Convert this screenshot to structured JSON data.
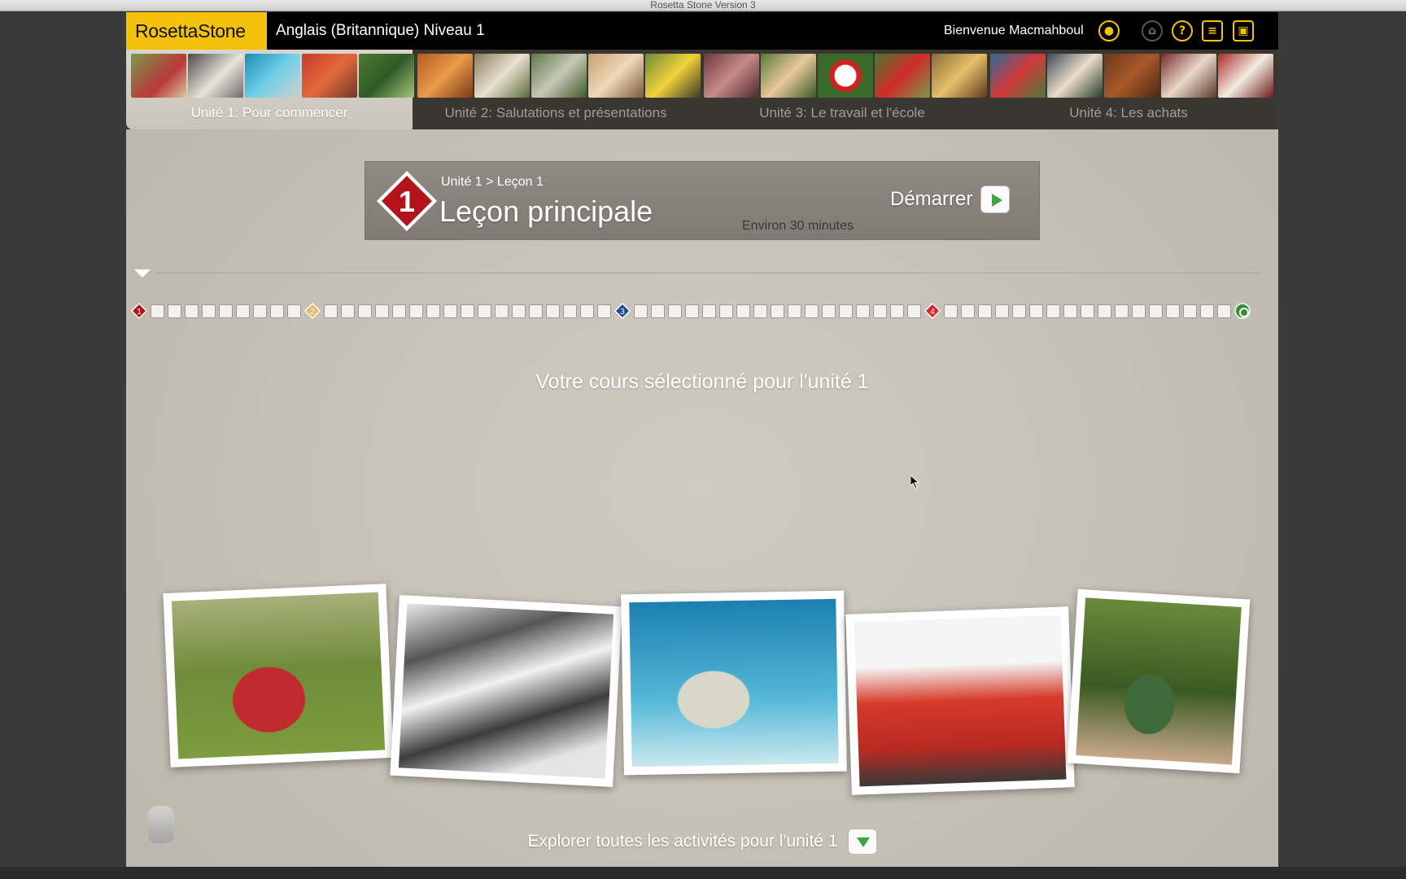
{
  "window": {
    "title": "Rosetta Stone Version 3"
  },
  "header": {
    "logo": "RosettaStone",
    "course_title": "Anglais (Britannique) Niveau 1",
    "welcome": "Bienvenue Macmahboul",
    "icons": [
      "user-icon",
      "home-icon",
      "help-icon",
      "menu-list-icon",
      "window-icon"
    ]
  },
  "units": [
    {
      "label": "Unité 1: Pour commencer",
      "active": true
    },
    {
      "label": "Unité 2: Salutations et présentations",
      "active": false
    },
    {
      "label": "Unité 3: Le travail et l'école",
      "active": false
    },
    {
      "label": "Unité 4: Les achats",
      "active": false
    }
  ],
  "lesson": {
    "number": "1",
    "breadcrumb": "Unité 1 > Leçon 1",
    "title": "Leçon principale",
    "duration": "Environ 30 minutes",
    "start_label": "Démarrer"
  },
  "timeline": {
    "markers": [
      "1",
      "2",
      "3",
      "4"
    ],
    "marker_colors": [
      "#b3131b",
      "#e8b86a",
      "#1c4aa0",
      "#d6242b"
    ]
  },
  "main": {
    "selected_course": "Votre cours sélectionné pour l'unité 1",
    "explore_label": "Explorer toutes les activités pour l'unité 1"
  },
  "colors": {
    "brand": "#f4c20d",
    "accent_green": "#3aa83a",
    "lesson_red": "#b3131b"
  }
}
